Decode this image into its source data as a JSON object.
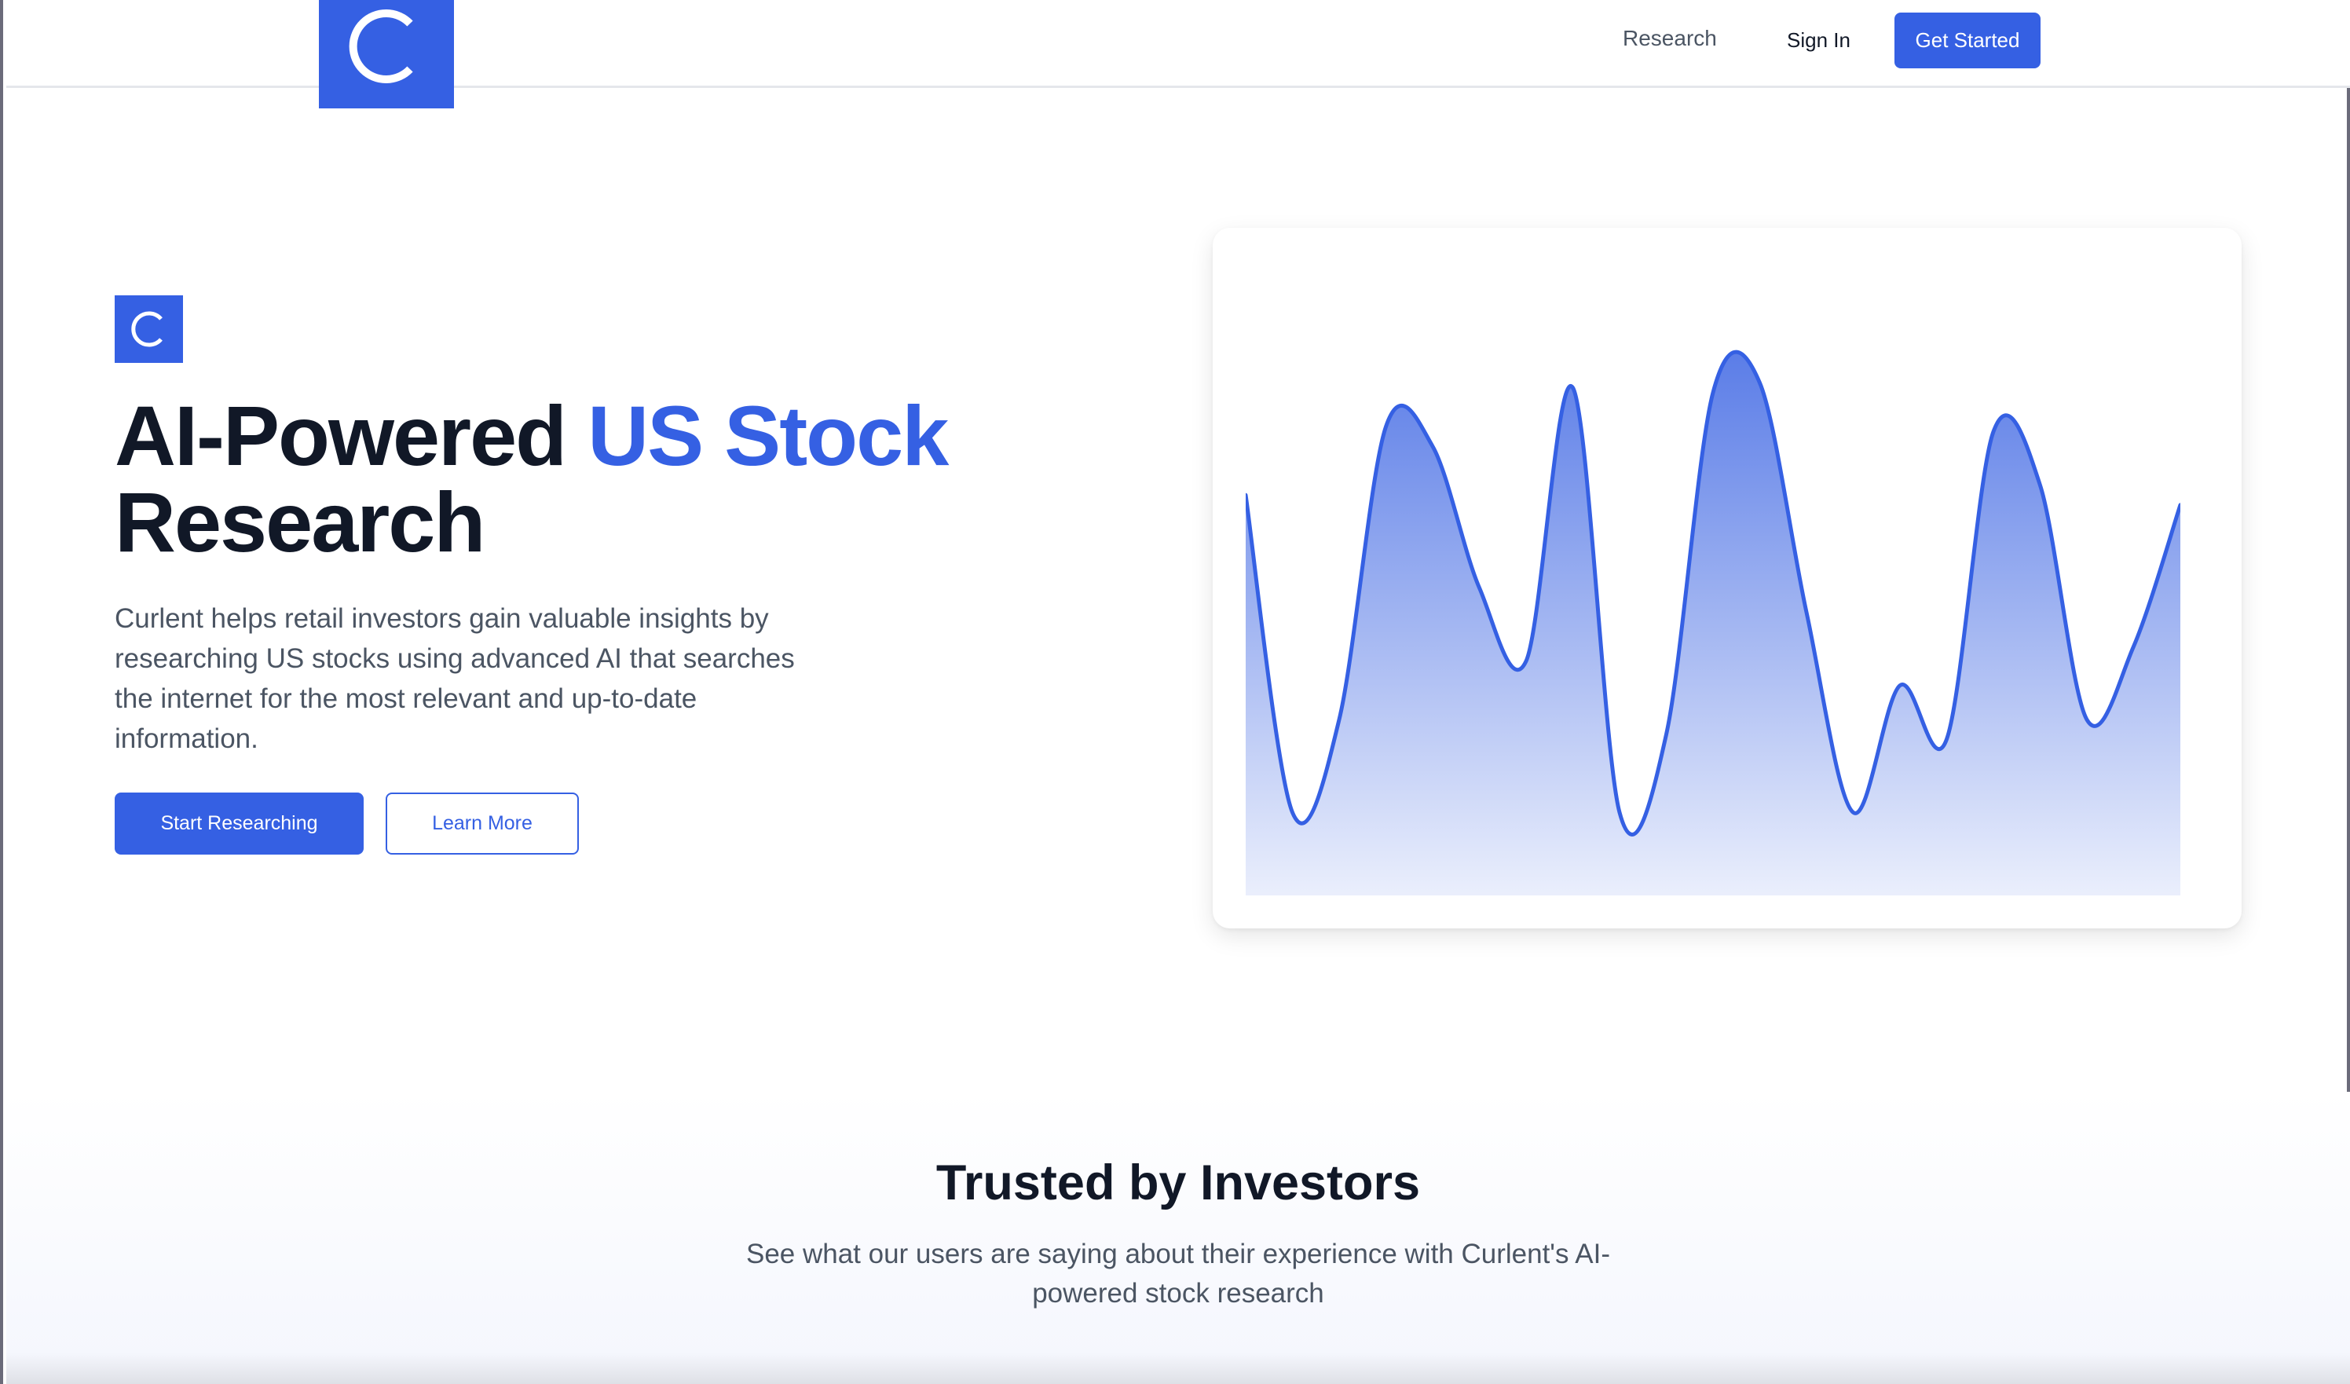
{
  "brand": {
    "logo_letter": "C",
    "color": "#3560e3"
  },
  "nav": {
    "research": "Research",
    "sign_in": "Sign In",
    "get_started": "Get Started"
  },
  "hero": {
    "title_part1": "AI-Powered ",
    "title_accent": "US Stock",
    "title_part2": "Research",
    "description": "Curlent helps retail investors gain valuable insights by researching US stocks using advanced AI that searches the internet for the most relevant and up-to-date information.",
    "primary_button": "Start Researching",
    "secondary_button": "Learn More"
  },
  "chart_data": {
    "type": "area",
    "x": [
      0,
      1,
      2,
      3,
      4,
      5,
      6,
      7,
      8,
      9,
      10,
      11,
      12,
      13,
      14,
      15,
      16,
      17,
      18,
      19,
      20
    ],
    "values": [
      82,
      17,
      36,
      96,
      92,
      63,
      48,
      104,
      17,
      33,
      103,
      105,
      58,
      17,
      43,
      32,
      95,
      84,
      36,
      51,
      80
    ],
    "ylim": [
      0,
      130
    ],
    "grid": false,
    "line_color": "#3560e3"
  },
  "trusted": {
    "title": "Trusted by Investors",
    "subtitle": "See what our users are saying about their experience with Curlent's AI-powered stock research"
  }
}
